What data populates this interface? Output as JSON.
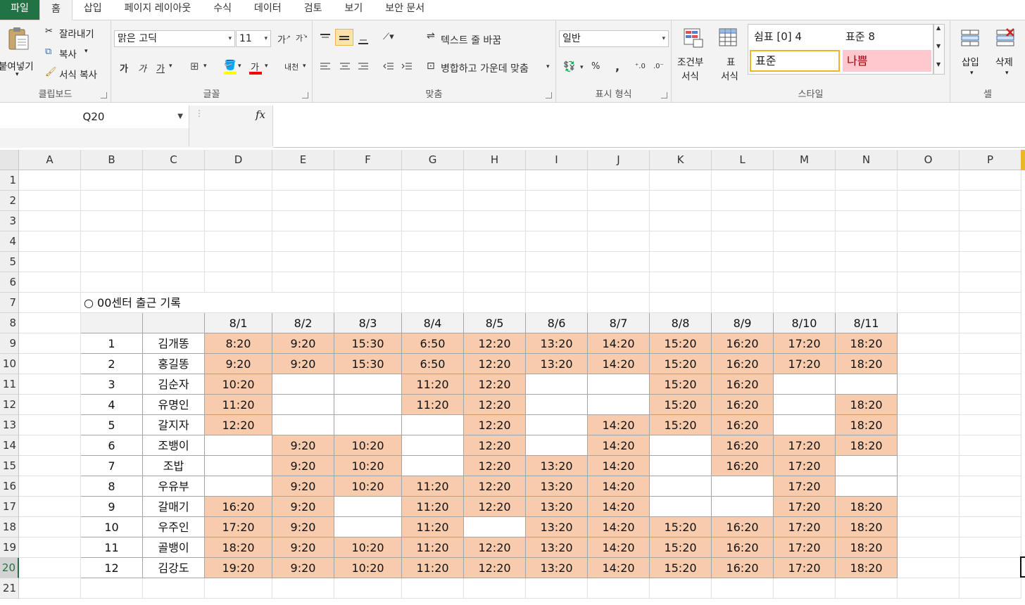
{
  "tabs": [
    "파일",
    "홈",
    "삽입",
    "페이지 레이아웃",
    "수식",
    "데이터",
    "검토",
    "보기",
    "보안 문서"
  ],
  "ribbon": {
    "clipboard": {
      "paste": "붙여넣기",
      "cut": "잘라내기",
      "copy": "복사",
      "format_painter": "서식 복사",
      "label": "클립보드"
    },
    "font": {
      "name": "맑은 고딕",
      "size": "11",
      "label": "글꼴",
      "bold": "가",
      "italic": "가",
      "underline": "가",
      "color_glyph": "가",
      "phonetic": "내천"
    },
    "alignment": {
      "wrap": "텍스트 줄 바꿈",
      "merge": "병합하고 가운데 맞춤",
      "label": "맞춤"
    },
    "number": {
      "format": "일반",
      "label": "표시 형식",
      "percent": "%",
      "comma": ","
    },
    "styles": {
      "conditional_1": "조건부",
      "conditional_2": "서식",
      "table_1": "표",
      "table_2": "서식",
      "style_comma": "쉼표 [0] 4",
      "style_normal8": "표준 8",
      "style_normal": "표준",
      "style_bad": "나쁨",
      "label": "스타일"
    },
    "cells": {
      "insert": "삽입",
      "delete": "삭제",
      "label": "셀"
    }
  },
  "formula": {
    "name_box": "Q20",
    "fx": "fx"
  },
  "columns": [
    "A",
    "B",
    "C",
    "D",
    "E",
    "F",
    "G",
    "H",
    "I",
    "J",
    "K",
    "L",
    "M",
    "N",
    "O",
    "P"
  ],
  "rows": [
    "1",
    "2",
    "3",
    "4",
    "5",
    "6",
    "7",
    "8",
    "9",
    "10",
    "11",
    "12",
    "13",
    "14",
    "15",
    "16",
    "17",
    "18",
    "19",
    "20",
    "21"
  ],
  "sheet": {
    "title": "○ 00센터 출근 기록",
    "dates": [
      "8/1",
      "8/2",
      "8/3",
      "8/4",
      "8/5",
      "8/6",
      "8/7",
      "8/8",
      "8/9",
      "8/10",
      "8/11"
    ],
    "records": [
      {
        "no": "1",
        "name": "김개똥",
        "times": [
          "8:20",
          "9:20",
          "15:30",
          "6:50",
          "12:20",
          "13:20",
          "14:20",
          "15:20",
          "16:20",
          "17:20",
          "18:20"
        ]
      },
      {
        "no": "2",
        "name": "홍길똥",
        "times": [
          "9:20",
          "9:20",
          "15:30",
          "6:50",
          "12:20",
          "13:20",
          "14:20",
          "15:20",
          "16:20",
          "17:20",
          "18:20"
        ]
      },
      {
        "no": "3",
        "name": "김순자",
        "times": [
          "10:20",
          "",
          "",
          "11:20",
          "12:20",
          "",
          "",
          "15:20",
          "16:20",
          "",
          ""
        ]
      },
      {
        "no": "4",
        "name": "유명인",
        "times": [
          "11:20",
          "",
          "",
          "11:20",
          "12:20",
          "",
          "",
          "15:20",
          "16:20",
          "",
          "18:20"
        ]
      },
      {
        "no": "5",
        "name": "갈지자",
        "times": [
          "12:20",
          "",
          "",
          "",
          "12:20",
          "",
          "14:20",
          "15:20",
          "16:20",
          "",
          "18:20"
        ]
      },
      {
        "no": "6",
        "name": "조뱅이",
        "times": [
          "",
          "9:20",
          "10:20",
          "",
          "12:20",
          "",
          "14:20",
          "",
          "16:20",
          "17:20",
          "18:20"
        ]
      },
      {
        "no": "7",
        "name": "조밥",
        "times": [
          "",
          "9:20",
          "10:20",
          "",
          "12:20",
          "13:20",
          "14:20",
          "",
          "16:20",
          "17:20",
          ""
        ]
      },
      {
        "no": "8",
        "name": "우유부",
        "times": [
          "",
          "9:20",
          "10:20",
          "11:20",
          "12:20",
          "13:20",
          "14:20",
          "",
          "",
          "17:20",
          ""
        ]
      },
      {
        "no": "9",
        "name": "갈매기",
        "times": [
          "16:20",
          "9:20",
          "",
          "11:20",
          "12:20",
          "13:20",
          "14:20",
          "",
          "",
          "17:20",
          "18:20"
        ]
      },
      {
        "no": "10",
        "name": "우주인",
        "times": [
          "17:20",
          "9:20",
          "",
          "11:20",
          "",
          "13:20",
          "14:20",
          "15:20",
          "16:20",
          "17:20",
          "18:20"
        ]
      },
      {
        "no": "11",
        "name": "골뱅이",
        "times": [
          "18:20",
          "9:20",
          "10:20",
          "11:20",
          "12:20",
          "13:20",
          "14:20",
          "15:20",
          "16:20",
          "17:20",
          "18:20"
        ]
      },
      {
        "no": "12",
        "name": "김강도",
        "times": [
          "19:20",
          "9:20",
          "10:20",
          "11:20",
          "12:20",
          "13:20",
          "14:20",
          "15:20",
          "16:20",
          "17:20",
          "18:20"
        ]
      }
    ]
  },
  "colors": {
    "accent": "#217346",
    "fill": "#f8cbad",
    "bad_bg": "#ffc7ce",
    "bad_text": "#9c0006"
  }
}
